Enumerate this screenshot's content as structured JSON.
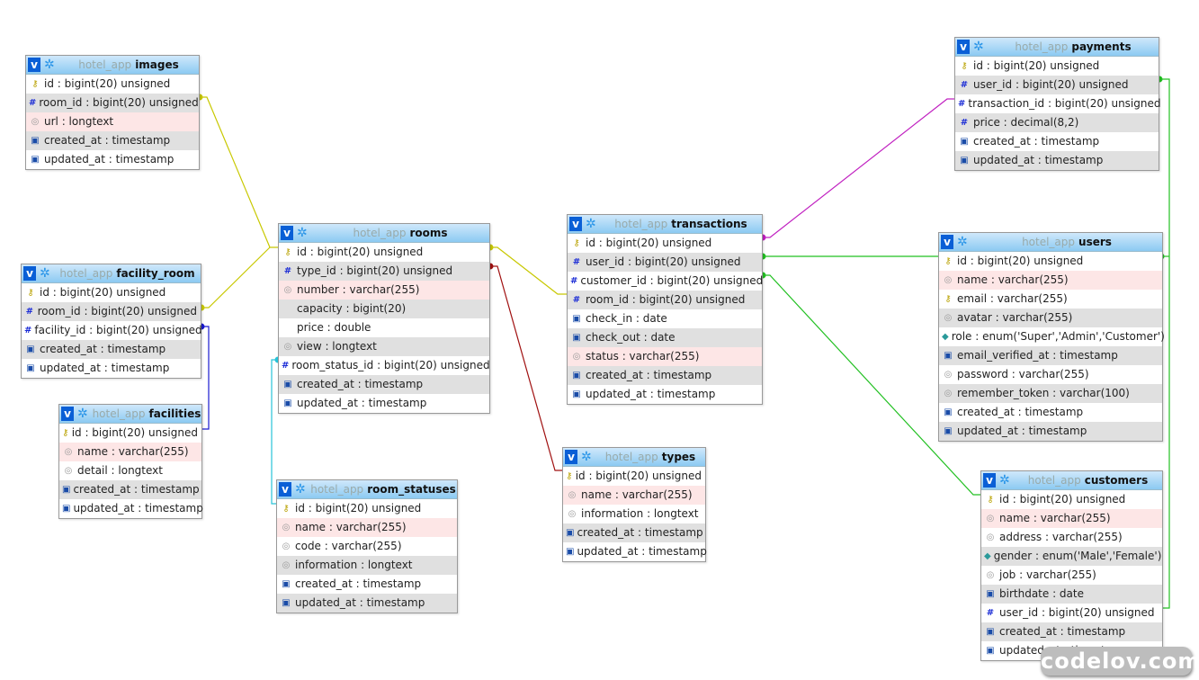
{
  "db": "hotel_app",
  "colors": {
    "yellow": "#c8c800",
    "blue": "#1a1ad0",
    "cyan": "#27c3d8",
    "darkred": "#a01010",
    "magenta": "#c020c0",
    "green": "#22c022"
  },
  "tables": [
    {
      "id": "images",
      "name": "images",
      "rows": [
        [
          "key",
          "id : bigint(20) unsigned",
          "white"
        ],
        [
          "hash",
          "room_id : bigint(20) unsigned",
          "gray"
        ],
        [
          "text",
          "url : longtext",
          "pink"
        ],
        [
          "date",
          "created_at : timestamp",
          "gray"
        ],
        [
          "date",
          "updated_at : timestamp",
          "white"
        ]
      ]
    },
    {
      "id": "facility_room",
      "name": "facility_room",
      "rows": [
        [
          "key",
          "id : bigint(20) unsigned",
          "white"
        ],
        [
          "hash",
          "room_id : bigint(20) unsigned",
          "gray"
        ],
        [
          "hash",
          "facility_id : bigint(20) unsigned",
          "white"
        ],
        [
          "date",
          "created_at : timestamp",
          "gray"
        ],
        [
          "date",
          "updated_at : timestamp",
          "white"
        ]
      ]
    },
    {
      "id": "facilities",
      "name": "facilities",
      "rows": [
        [
          "key",
          "id : bigint(20) unsigned",
          "white"
        ],
        [
          "text",
          "name : varchar(255)",
          "pink"
        ],
        [
          "text",
          "detail : longtext",
          "white"
        ],
        [
          "date",
          "created_at : timestamp",
          "gray"
        ],
        [
          "date",
          "updated_at : timestamp",
          "white"
        ]
      ]
    },
    {
      "id": "rooms",
      "name": "rooms",
      "rows": [
        [
          "key",
          "id : bigint(20) unsigned",
          "white"
        ],
        [
          "hash",
          "type_id : bigint(20) unsigned",
          "gray"
        ],
        [
          "text",
          "number : varchar(255)",
          "pink"
        ],
        [
          "",
          "capacity : bigint(20)",
          "gray"
        ],
        [
          "",
          "price : double",
          "white"
        ],
        [
          "text",
          "view : longtext",
          "gray"
        ],
        [
          "hash",
          "room_status_id : bigint(20) unsigned",
          "white"
        ],
        [
          "date",
          "created_at : timestamp",
          "gray"
        ],
        [
          "date",
          "updated_at : timestamp",
          "white"
        ]
      ]
    },
    {
      "id": "room_statuses",
      "name": "room_statuses",
      "rows": [
        [
          "key",
          "id : bigint(20) unsigned",
          "white"
        ],
        [
          "text",
          "name : varchar(255)",
          "pink"
        ],
        [
          "text",
          "code : varchar(255)",
          "white"
        ],
        [
          "text",
          "information : longtext",
          "gray"
        ],
        [
          "date",
          "created_at : timestamp",
          "white"
        ],
        [
          "date",
          "updated_at : timestamp",
          "gray"
        ]
      ]
    },
    {
      "id": "transactions",
      "name": "transactions",
      "rows": [
        [
          "key",
          "id : bigint(20) unsigned",
          "white"
        ],
        [
          "hash",
          "user_id : bigint(20) unsigned",
          "gray"
        ],
        [
          "hash",
          "customer_id : bigint(20) unsigned",
          "white"
        ],
        [
          "hash",
          "room_id : bigint(20) unsigned",
          "gray"
        ],
        [
          "date",
          "check_in : date",
          "white"
        ],
        [
          "date",
          "check_out : date",
          "gray"
        ],
        [
          "text",
          "status : varchar(255)",
          "pink"
        ],
        [
          "date",
          "created_at : timestamp",
          "gray"
        ],
        [
          "date",
          "updated_at : timestamp",
          "white"
        ]
      ]
    },
    {
      "id": "types",
      "name": "types",
      "rows": [
        [
          "key",
          "id : bigint(20) unsigned",
          "white"
        ],
        [
          "text",
          "name : varchar(255)",
          "pink"
        ],
        [
          "text",
          "information : longtext",
          "white"
        ],
        [
          "date",
          "created_at : timestamp",
          "gray"
        ],
        [
          "date",
          "updated_at : timestamp",
          "white"
        ]
      ]
    },
    {
      "id": "payments",
      "name": "payments",
      "rows": [
        [
          "key",
          "id : bigint(20) unsigned",
          "white"
        ],
        [
          "hash",
          "user_id : bigint(20) unsigned",
          "gray"
        ],
        [
          "hash",
          "transaction_id : bigint(20) unsigned",
          "white"
        ],
        [
          "hash",
          "price : decimal(8,2)",
          "gray"
        ],
        [
          "date",
          "created_at : timestamp",
          "white"
        ],
        [
          "date",
          "updated_at : timestamp",
          "gray"
        ]
      ]
    },
    {
      "id": "users",
      "name": "users",
      "rows": [
        [
          "key",
          "id : bigint(20) unsigned",
          "white"
        ],
        [
          "text",
          "name : varchar(255)",
          "pink"
        ],
        [
          "key",
          "email : varchar(255)",
          "white"
        ],
        [
          "text",
          "avatar : varchar(255)",
          "gray"
        ],
        [
          "enum",
          "role : enum('Super','Admin','Customer')",
          "white"
        ],
        [
          "date",
          "email_verified_at : timestamp",
          "gray"
        ],
        [
          "text",
          "password : varchar(255)",
          "white"
        ],
        [
          "text",
          "remember_token : varchar(100)",
          "gray"
        ],
        [
          "date",
          "created_at : timestamp",
          "white"
        ],
        [
          "date",
          "updated_at : timestamp",
          "gray"
        ]
      ]
    },
    {
      "id": "customers",
      "name": "customers",
      "rows": [
        [
          "key",
          "id : bigint(20) unsigned",
          "white"
        ],
        [
          "text",
          "name : varchar(255)",
          "pink"
        ],
        [
          "text",
          "address : varchar(255)",
          "white"
        ],
        [
          "enum",
          "gender : enum('Male','Female')",
          "gray"
        ],
        [
          "text",
          "job : varchar(255)",
          "white"
        ],
        [
          "date",
          "birthdate : date",
          "gray"
        ],
        [
          "hash",
          "user_id : bigint(20) unsigned",
          "white"
        ],
        [
          "date",
          "created_at : timestamp",
          "gray"
        ],
        [
          "date",
          "updated_at : timestamp",
          "white"
        ]
      ]
    }
  ],
  "watermark": "codelov.com"
}
